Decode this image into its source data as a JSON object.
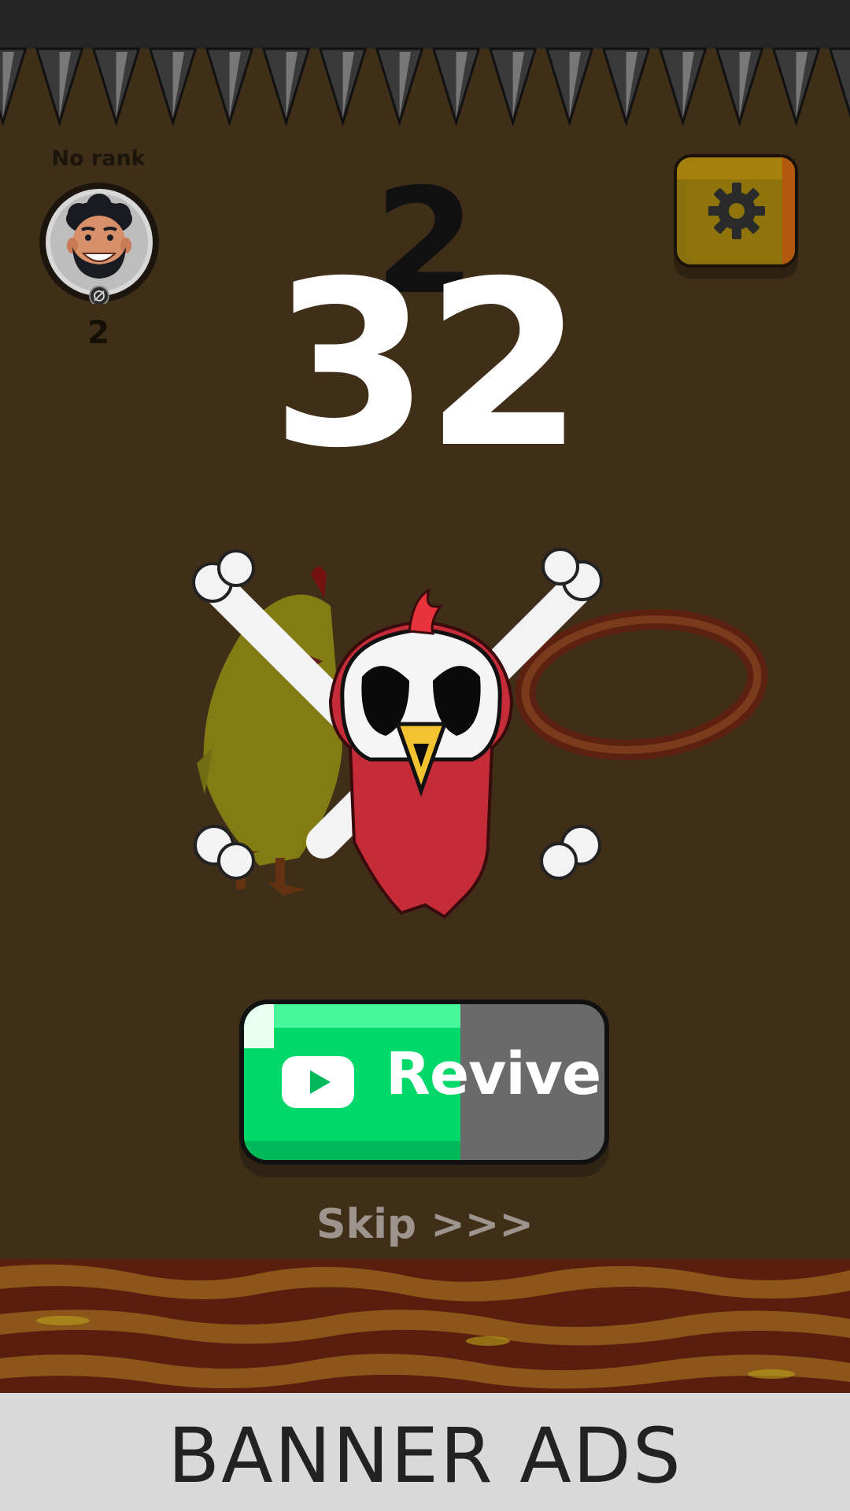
{
  "player": {
    "rank_label": "No rank",
    "rank_value": "2"
  },
  "score": {
    "best": "2",
    "current": "32"
  },
  "revive": {
    "label": "Revive",
    "timer_progress": 0.6
  },
  "skip": {
    "label": "Skip >>>"
  },
  "banner": {
    "label": "BANNER ADS"
  },
  "icons": {
    "settings": "gear-icon",
    "revive": "play-icon",
    "avatar": "avatar-icon",
    "death": "skull-crossbones-icon"
  },
  "colors": {
    "background": "#3f2f19",
    "revive_green": "#00d86a",
    "settings_yellow": "#8a6f0e"
  }
}
